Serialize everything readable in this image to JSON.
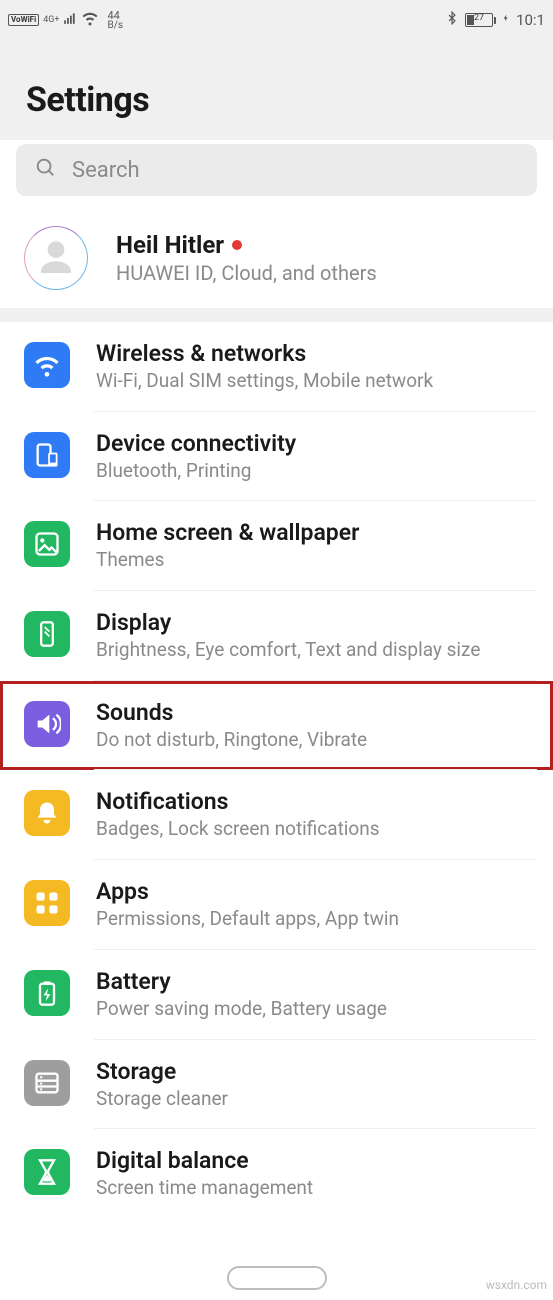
{
  "status": {
    "vowifi": "VoWiFi",
    "net": "4G+",
    "speed_val": "44",
    "speed_unit": "B/s",
    "battery": "27",
    "time": "10:1"
  },
  "header": {
    "title": "Settings"
  },
  "search": {
    "placeholder": "Search"
  },
  "account": {
    "name": "Heil Hitler",
    "subtitle": "HUAWEI ID, Cloud, and others"
  },
  "items": [
    {
      "key": "wireless",
      "title": "Wireless & networks",
      "subtitle": "Wi-Fi, Dual SIM settings, Mobile network",
      "color": "#2f7af5"
    },
    {
      "key": "device",
      "title": "Device connectivity",
      "subtitle": "Bluetooth, Printing",
      "color": "#2f7af5"
    },
    {
      "key": "homescreen",
      "title": "Home screen & wallpaper",
      "subtitle": "Themes",
      "color": "#22b861"
    },
    {
      "key": "display",
      "title": "Display",
      "subtitle": "Brightness, Eye comfort, Text and display size",
      "color": "#22b861"
    },
    {
      "key": "sounds",
      "title": "Sounds",
      "subtitle": "Do not disturb, Ringtone, Vibrate",
      "color": "#7a5ee0",
      "highlighted": true
    },
    {
      "key": "notifications",
      "title": "Notifications",
      "subtitle": "Badges, Lock screen notifications",
      "color": "#f5b924"
    },
    {
      "key": "apps",
      "title": "Apps",
      "subtitle": "Permissions, Default apps, App twin",
      "color": "#f5b924"
    },
    {
      "key": "battery",
      "title": "Battery",
      "subtitle": "Power saving mode, Battery usage",
      "color": "#22b861"
    },
    {
      "key": "storage",
      "title": "Storage",
      "subtitle": "Storage cleaner",
      "color": "#9e9e9e"
    },
    {
      "key": "digital",
      "title": "Digital balance",
      "subtitle": "Screen time management",
      "color": "#22b861"
    }
  ],
  "watermark": "wsxdn.com"
}
